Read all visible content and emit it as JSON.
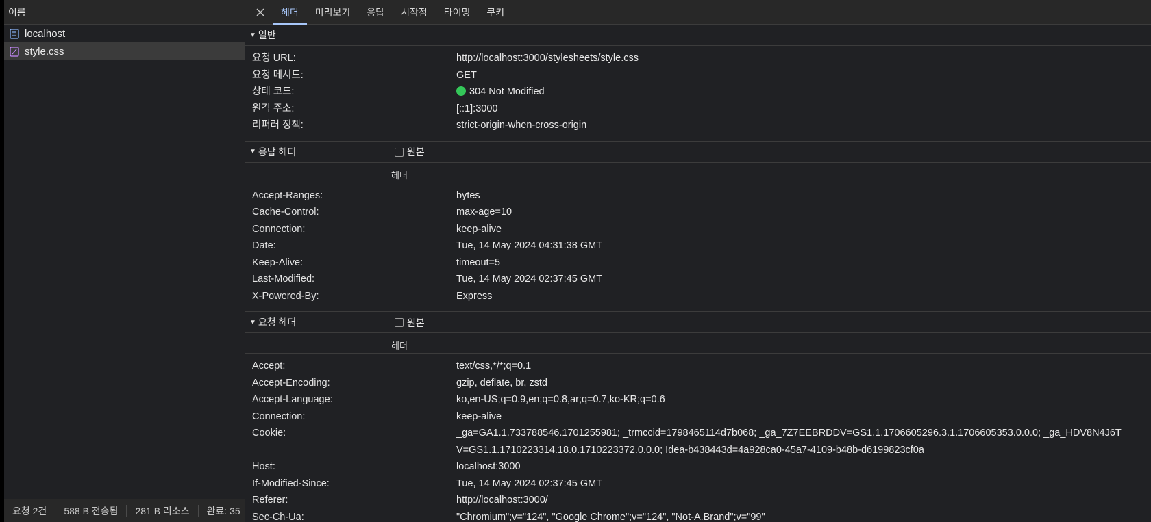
{
  "colors": {
    "accent": "#a8c7fa",
    "status_ok": "#34c759",
    "doc_icon": "#8ab4f8",
    "css_icon": "#c58af9"
  },
  "left": {
    "header": "이름",
    "requests": [
      {
        "name": "localhost",
        "icon": "document-icon"
      },
      {
        "name": "style.css",
        "icon": "stylesheet-icon"
      }
    ],
    "status_bar": {
      "requests": "요청 2건",
      "transferred": "588 B 전송됨",
      "resources": "281 B 리소스",
      "finish": "완료: 35"
    }
  },
  "tabs": [
    "헤더",
    "미리보기",
    "응답",
    "시작점",
    "타이밍",
    "쿠키"
  ],
  "active_tab": "헤더",
  "general": {
    "title": "일반",
    "rows": [
      {
        "k": "요청 URL:",
        "v": "http://localhost:3000/stylesheets/style.css"
      },
      {
        "k": "요청 메서드:",
        "v": "GET"
      },
      {
        "k": "상태 코드:",
        "v": "304 Not Modified"
      },
      {
        "k": "원격 주소:",
        "v": "[::1]:3000"
      },
      {
        "k": "리퍼러 정책:",
        "v": "strict-origin-when-cross-origin"
      }
    ]
  },
  "response_headers": {
    "title": "응답 헤더",
    "raw_label": "원본",
    "col_label": "헤더",
    "rows": [
      {
        "k": "Accept-Ranges:",
        "v": "bytes"
      },
      {
        "k": "Cache-Control:",
        "v": "max-age=10"
      },
      {
        "k": "Connection:",
        "v": "keep-alive"
      },
      {
        "k": "Date:",
        "v": "Tue, 14 May 2024 04:31:38 GMT"
      },
      {
        "k": "Keep-Alive:",
        "v": "timeout=5"
      },
      {
        "k": "Last-Modified:",
        "v": "Tue, 14 May 2024 02:37:45 GMT"
      },
      {
        "k": "X-Powered-By:",
        "v": "Express"
      }
    ]
  },
  "request_headers": {
    "title": "요청 헤더",
    "raw_label": "원본",
    "col_label": "헤더",
    "rows": [
      {
        "k": "Accept:",
        "v": "text/css,*/*;q=0.1"
      },
      {
        "k": "Accept-Encoding:",
        "v": "gzip, deflate, br, zstd"
      },
      {
        "k": "Accept-Language:",
        "v": "ko,en-US;q=0.9,en;q=0.8,ar;q=0.7,ko-KR;q=0.6"
      },
      {
        "k": "Connection:",
        "v": "keep-alive"
      },
      {
        "k": "Cookie:",
        "v": "_ga=GA1.1.733788546.1701255981; _trmccid=1798465114d7b068; _ga_7Z7EEBRDDV=GS1.1.1706605296.3.1.1706605353.0.0.0; _ga_HDV8N4J6TV=GS1.1.1710223314.18.0.1710223372.0.0.0; Idea-b438443d=4a928ca0-45a7-4109-b48b-d6199823cf0a"
      },
      {
        "k": "Host:",
        "v": "localhost:3000"
      },
      {
        "k": "If-Modified-Since:",
        "v": "Tue, 14 May 2024 02:37:45 GMT"
      },
      {
        "k": "Referer:",
        "v": "http://localhost:3000/"
      },
      {
        "k": "Sec-Ch-Ua:",
        "v": "\"Chromium\";v=\"124\", \"Google Chrome\";v=\"124\", \"Not-A.Brand\";v=\"99\""
      }
    ]
  }
}
